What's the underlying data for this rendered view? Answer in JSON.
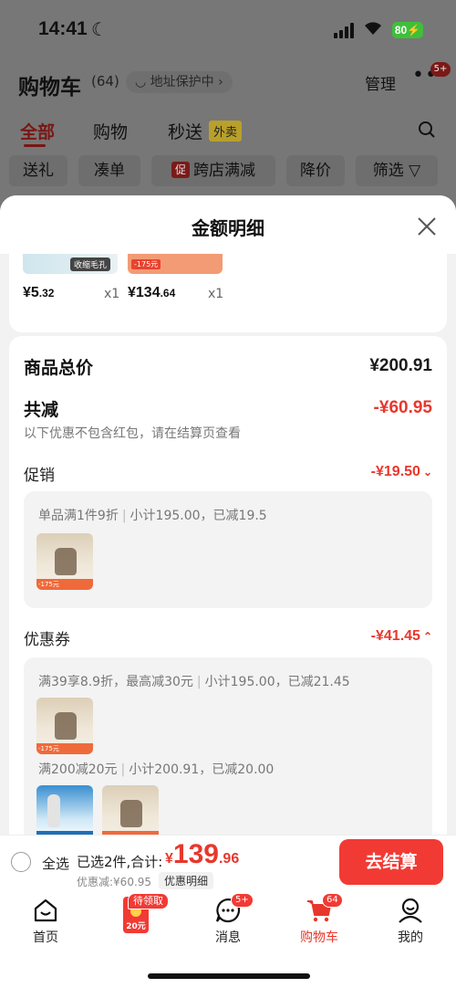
{
  "status_bar": {
    "time": "14:41",
    "battery": "80"
  },
  "header": {
    "title": "购物车",
    "count": "(64)",
    "address_chip": "地址保护中",
    "manage_label": "管理",
    "more_badge": "5+"
  },
  "tabs": {
    "items": [
      "全部",
      "购物",
      "秒送"
    ],
    "waimai_tag": "外卖"
  },
  "filters": {
    "gift": "送礼",
    "bundle": "凑单",
    "promo_tag": "促",
    "store_discount": "跨店满减",
    "price_drop": "降价",
    "filter": "筛选"
  },
  "sheet": {
    "title": "金额明细",
    "products": [
      {
        "tag": "收缩毛孔",
        "price_int": "¥5",
        "price_dec": ".32",
        "qty": "x1"
      },
      {
        "tag": "-175元",
        "price_int": "¥134",
        "price_dec": ".64",
        "qty": "x1"
      }
    ],
    "goods_total_label": "商品总价",
    "goods_total_value": "¥200.91",
    "total_reduce_label": "共减",
    "total_reduce_value": "-¥60.95",
    "note": "以下优惠不包含红包，请在结算页查看",
    "promotion": {
      "label": "促销",
      "value": "-¥19.50",
      "rule": "单品满1件9折",
      "detail": "小计195.00，已减19.5",
      "img_tag": "-175元"
    },
    "coupon": {
      "label": "优惠券",
      "value": "-¥41.45",
      "rule1": "满39享8.9折，最高减30元",
      "detail1": "小计195.00，已减21.45",
      "rule2": "满200减20元",
      "detail2": "小计200.91，已减20.00",
      "img_tag": "-175元"
    }
  },
  "checkout": {
    "select_all": "全选",
    "selected": "已选2件,合计:",
    "total_symbol": "¥",
    "total_int": "139",
    "total_dec": ".96",
    "discount": "优惠减:¥60.95",
    "detail_button": "优惠明细",
    "pay_button": "去结算"
  },
  "tabbar": {
    "home": "首页",
    "hongbao_pending": "待领取",
    "hongbao_amount": "20元",
    "messages": "消息",
    "messages_badge": "5+",
    "cart": "购物车",
    "cart_badge": "64",
    "me": "我的"
  },
  "colors": {
    "accent_red": "#e8372c",
    "pay_button": "#f23a34",
    "battery_green": "#3fbf3a"
  }
}
